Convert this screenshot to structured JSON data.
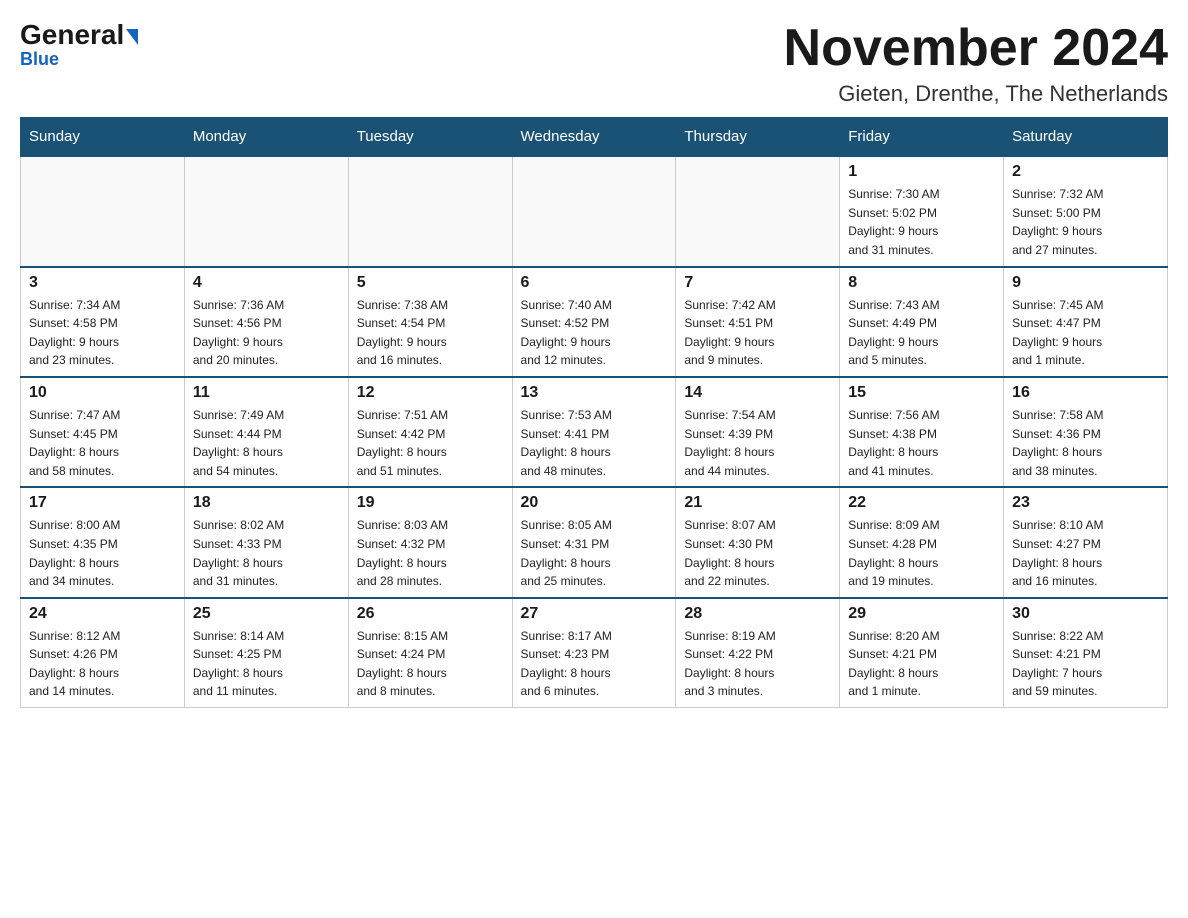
{
  "header": {
    "logo_general": "General",
    "logo_blue": "Blue",
    "month_title": "November 2024",
    "location": "Gieten, Drenthe, The Netherlands"
  },
  "days_of_week": [
    "Sunday",
    "Monday",
    "Tuesday",
    "Wednesday",
    "Thursday",
    "Friday",
    "Saturday"
  ],
  "weeks": [
    [
      {
        "day": "",
        "info": ""
      },
      {
        "day": "",
        "info": ""
      },
      {
        "day": "",
        "info": ""
      },
      {
        "day": "",
        "info": ""
      },
      {
        "day": "",
        "info": ""
      },
      {
        "day": "1",
        "info": "Sunrise: 7:30 AM\nSunset: 5:02 PM\nDaylight: 9 hours\nand 31 minutes."
      },
      {
        "day": "2",
        "info": "Sunrise: 7:32 AM\nSunset: 5:00 PM\nDaylight: 9 hours\nand 27 minutes."
      }
    ],
    [
      {
        "day": "3",
        "info": "Sunrise: 7:34 AM\nSunset: 4:58 PM\nDaylight: 9 hours\nand 23 minutes."
      },
      {
        "day": "4",
        "info": "Sunrise: 7:36 AM\nSunset: 4:56 PM\nDaylight: 9 hours\nand 20 minutes."
      },
      {
        "day": "5",
        "info": "Sunrise: 7:38 AM\nSunset: 4:54 PM\nDaylight: 9 hours\nand 16 minutes."
      },
      {
        "day": "6",
        "info": "Sunrise: 7:40 AM\nSunset: 4:52 PM\nDaylight: 9 hours\nand 12 minutes."
      },
      {
        "day": "7",
        "info": "Sunrise: 7:42 AM\nSunset: 4:51 PM\nDaylight: 9 hours\nand 9 minutes."
      },
      {
        "day": "8",
        "info": "Sunrise: 7:43 AM\nSunset: 4:49 PM\nDaylight: 9 hours\nand 5 minutes."
      },
      {
        "day": "9",
        "info": "Sunrise: 7:45 AM\nSunset: 4:47 PM\nDaylight: 9 hours\nand 1 minute."
      }
    ],
    [
      {
        "day": "10",
        "info": "Sunrise: 7:47 AM\nSunset: 4:45 PM\nDaylight: 8 hours\nand 58 minutes."
      },
      {
        "day": "11",
        "info": "Sunrise: 7:49 AM\nSunset: 4:44 PM\nDaylight: 8 hours\nand 54 minutes."
      },
      {
        "day": "12",
        "info": "Sunrise: 7:51 AM\nSunset: 4:42 PM\nDaylight: 8 hours\nand 51 minutes."
      },
      {
        "day": "13",
        "info": "Sunrise: 7:53 AM\nSunset: 4:41 PM\nDaylight: 8 hours\nand 48 minutes."
      },
      {
        "day": "14",
        "info": "Sunrise: 7:54 AM\nSunset: 4:39 PM\nDaylight: 8 hours\nand 44 minutes."
      },
      {
        "day": "15",
        "info": "Sunrise: 7:56 AM\nSunset: 4:38 PM\nDaylight: 8 hours\nand 41 minutes."
      },
      {
        "day": "16",
        "info": "Sunrise: 7:58 AM\nSunset: 4:36 PM\nDaylight: 8 hours\nand 38 minutes."
      }
    ],
    [
      {
        "day": "17",
        "info": "Sunrise: 8:00 AM\nSunset: 4:35 PM\nDaylight: 8 hours\nand 34 minutes."
      },
      {
        "day": "18",
        "info": "Sunrise: 8:02 AM\nSunset: 4:33 PM\nDaylight: 8 hours\nand 31 minutes."
      },
      {
        "day": "19",
        "info": "Sunrise: 8:03 AM\nSunset: 4:32 PM\nDaylight: 8 hours\nand 28 minutes."
      },
      {
        "day": "20",
        "info": "Sunrise: 8:05 AM\nSunset: 4:31 PM\nDaylight: 8 hours\nand 25 minutes."
      },
      {
        "day": "21",
        "info": "Sunrise: 8:07 AM\nSunset: 4:30 PM\nDaylight: 8 hours\nand 22 minutes."
      },
      {
        "day": "22",
        "info": "Sunrise: 8:09 AM\nSunset: 4:28 PM\nDaylight: 8 hours\nand 19 minutes."
      },
      {
        "day": "23",
        "info": "Sunrise: 8:10 AM\nSunset: 4:27 PM\nDaylight: 8 hours\nand 16 minutes."
      }
    ],
    [
      {
        "day": "24",
        "info": "Sunrise: 8:12 AM\nSunset: 4:26 PM\nDaylight: 8 hours\nand 14 minutes."
      },
      {
        "day": "25",
        "info": "Sunrise: 8:14 AM\nSunset: 4:25 PM\nDaylight: 8 hours\nand 11 minutes."
      },
      {
        "day": "26",
        "info": "Sunrise: 8:15 AM\nSunset: 4:24 PM\nDaylight: 8 hours\nand 8 minutes."
      },
      {
        "day": "27",
        "info": "Sunrise: 8:17 AM\nSunset: 4:23 PM\nDaylight: 8 hours\nand 6 minutes."
      },
      {
        "day": "28",
        "info": "Sunrise: 8:19 AM\nSunset: 4:22 PM\nDaylight: 8 hours\nand 3 minutes."
      },
      {
        "day": "29",
        "info": "Sunrise: 8:20 AM\nSunset: 4:21 PM\nDaylight: 8 hours\nand 1 minute."
      },
      {
        "day": "30",
        "info": "Sunrise: 8:22 AM\nSunset: 4:21 PM\nDaylight: 7 hours\nand 59 minutes."
      }
    ]
  ]
}
